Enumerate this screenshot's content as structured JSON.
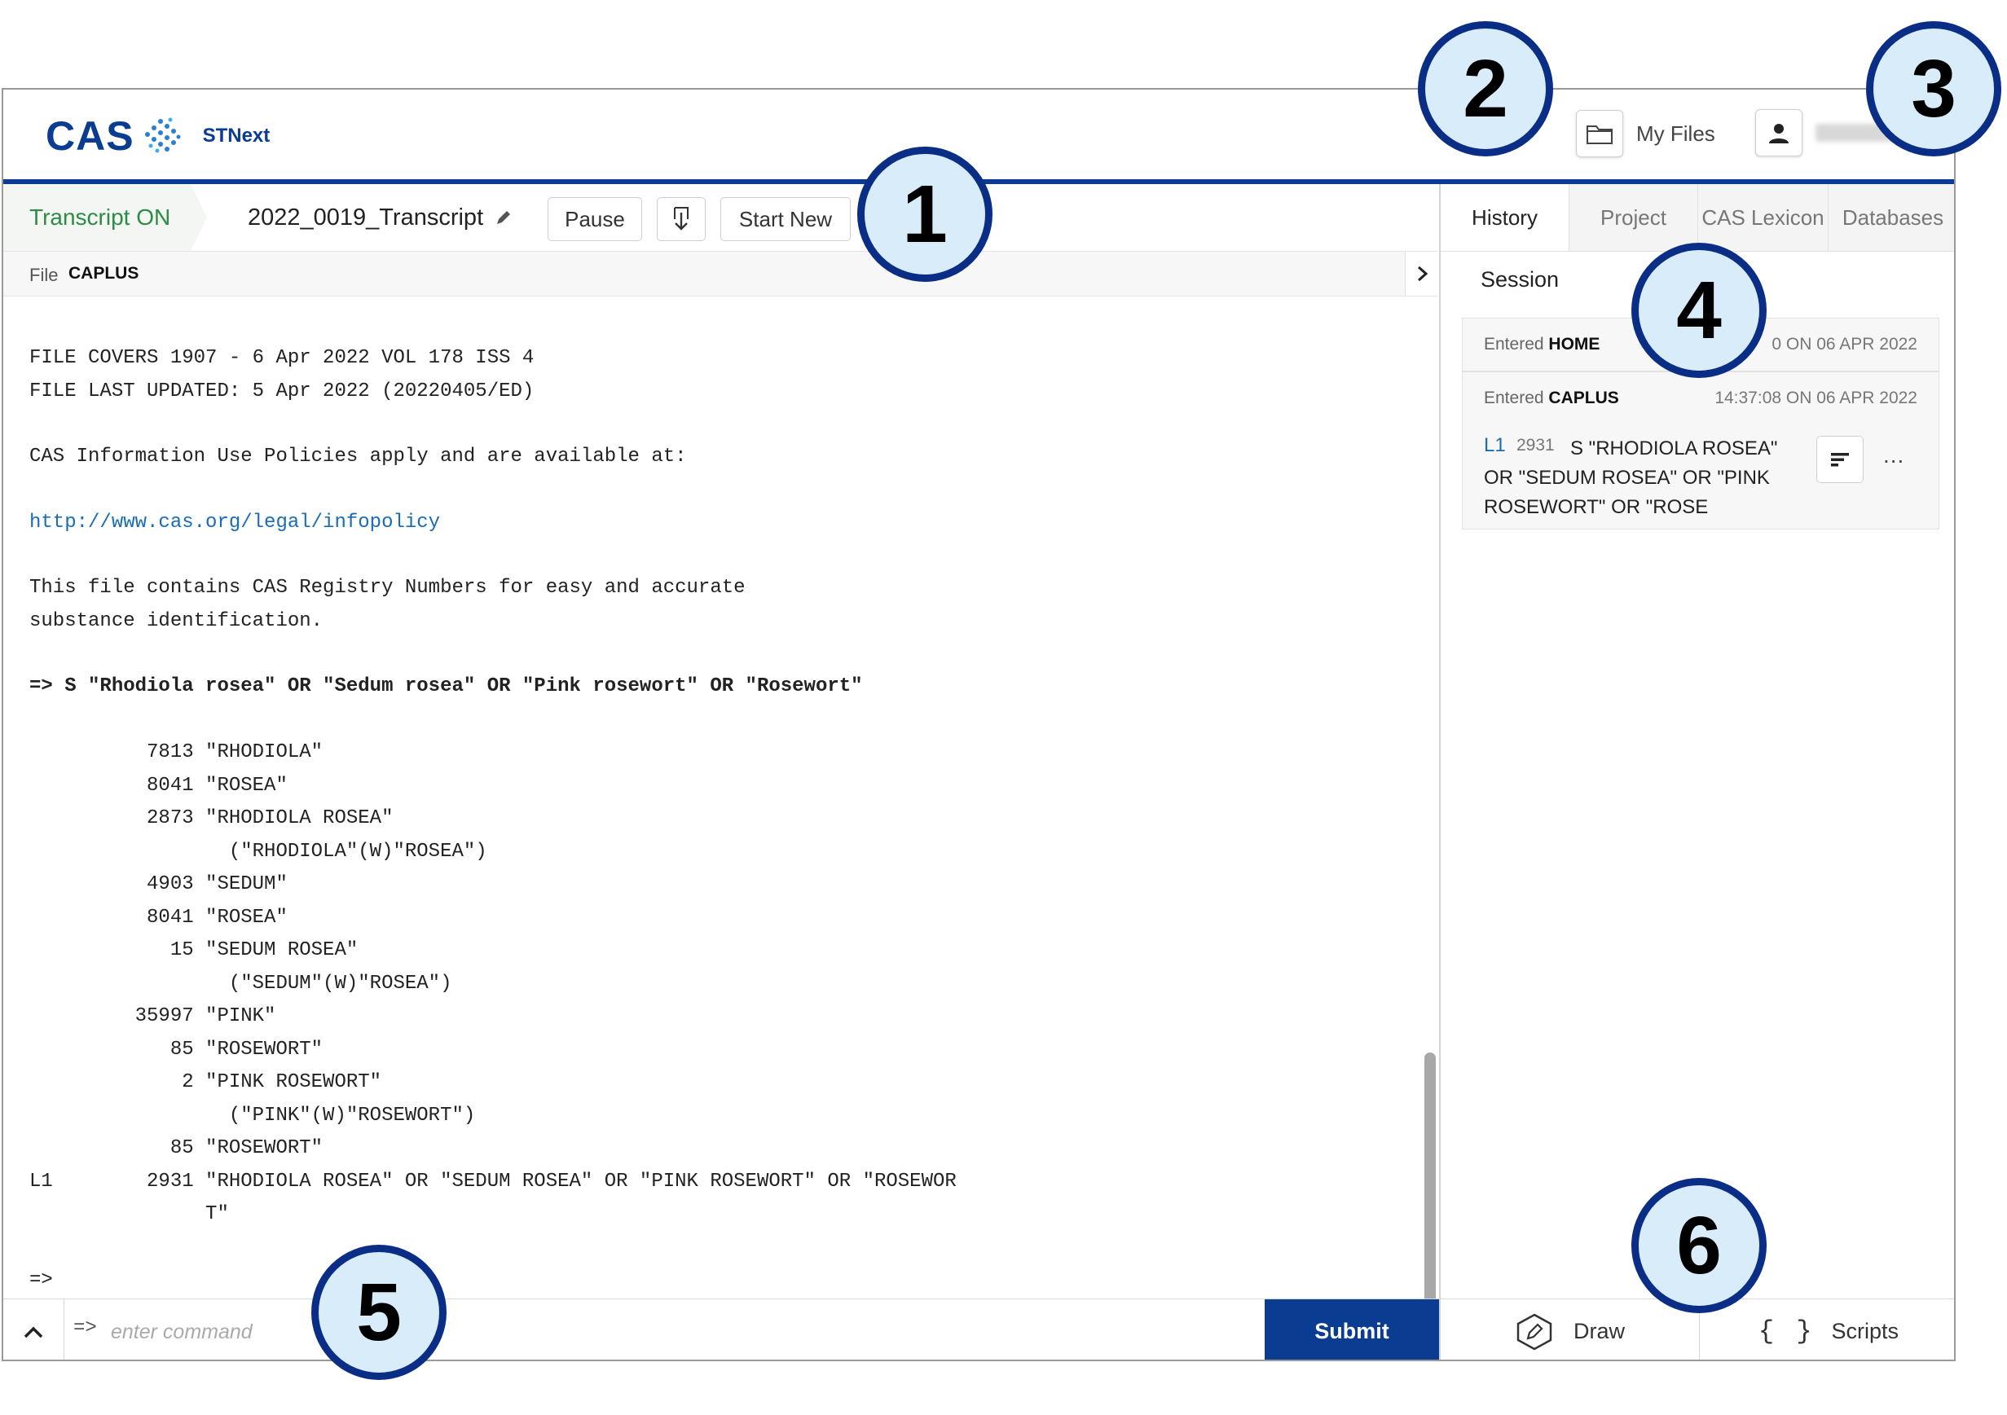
{
  "header": {
    "logo_text": "CAS",
    "product": "STNext",
    "my_files": "My Files",
    "brand_color": "#0a3d91"
  },
  "toolbar": {
    "transcript_status": "Transcript ON",
    "transcript_name": "2022_0019_Transcript",
    "pause": "Pause",
    "start_new": "Start New"
  },
  "file_bar": {
    "label": "File",
    "value": "CAPLUS"
  },
  "transcript": {
    "lines": [
      "FILE COVERS 1907 - 6 Apr 2022 VOL 178 ISS 4",
      "FILE LAST UPDATED: 5 Apr 2022 (20220405/ED)",
      "CAS Information Use Policies apply and are available at:",
      "http://www.cas.org/legal/infopolicy",
      "This file contains CAS Registry Numbers for easy and accurate",
      "substance identification.",
      "=> S \"Rhodiola rosea\" OR \"Sedum rosea\" OR \"Pink rosewort\" OR \"Rosewort\"",
      "          7813 \"RHODIOLA\"",
      "          8041 \"ROSEA\"",
      "          2873 \"RHODIOLA ROSEA\"",
      "                 (\"RHODIOLA\"(W)\"ROSEA\")",
      "          4903 \"SEDUM\"",
      "          8041 \"ROSEA\"",
      "            15 \"SEDUM ROSEA\"",
      "                 (\"SEDUM\"(W)\"ROSEA\")",
      "         35997 \"PINK\"",
      "            85 \"ROSEWORT\"",
      "             2 \"PINK ROSEWORT\"",
      "                 (\"PINK\"(W)\"ROSEWORT\")",
      "            85 \"ROSEWORT\"",
      "L1        2931 \"RHODIOLA ROSEA\" OR \"SEDUM ROSEA\" OR \"PINK ROSEWORT\" OR \"ROSEWOR",
      "               T\"",
      "=>"
    ]
  },
  "command": {
    "prompt": "=>",
    "placeholder": "enter command",
    "submit": "Submit"
  },
  "tabs": [
    "History",
    "Project",
    "CAS Lexicon",
    "Databases"
  ],
  "history": {
    "section": "Session",
    "entries": [
      {
        "entered_label": "Entered",
        "entered": "HOME",
        "time": "0 ON 06 APR 2022"
      },
      {
        "entered_label": "Entered",
        "entered": "CAPLUS",
        "time": "14:37:08 ON 06 APR 2022"
      }
    ],
    "query": {
      "label": "L1",
      "count": "2931",
      "text": "S \"RHODIOLA ROSEA\" OR \"SEDUM ROSEA\" OR \"PINK ROSEWORT\" OR \"ROSE",
      "more": "..."
    }
  },
  "right_bottom": {
    "draw": "Draw",
    "scripts": "Scripts",
    "scripts_glyph": "{ }"
  },
  "callouts": [
    "1",
    "2",
    "3",
    "4",
    "5",
    "6"
  ]
}
